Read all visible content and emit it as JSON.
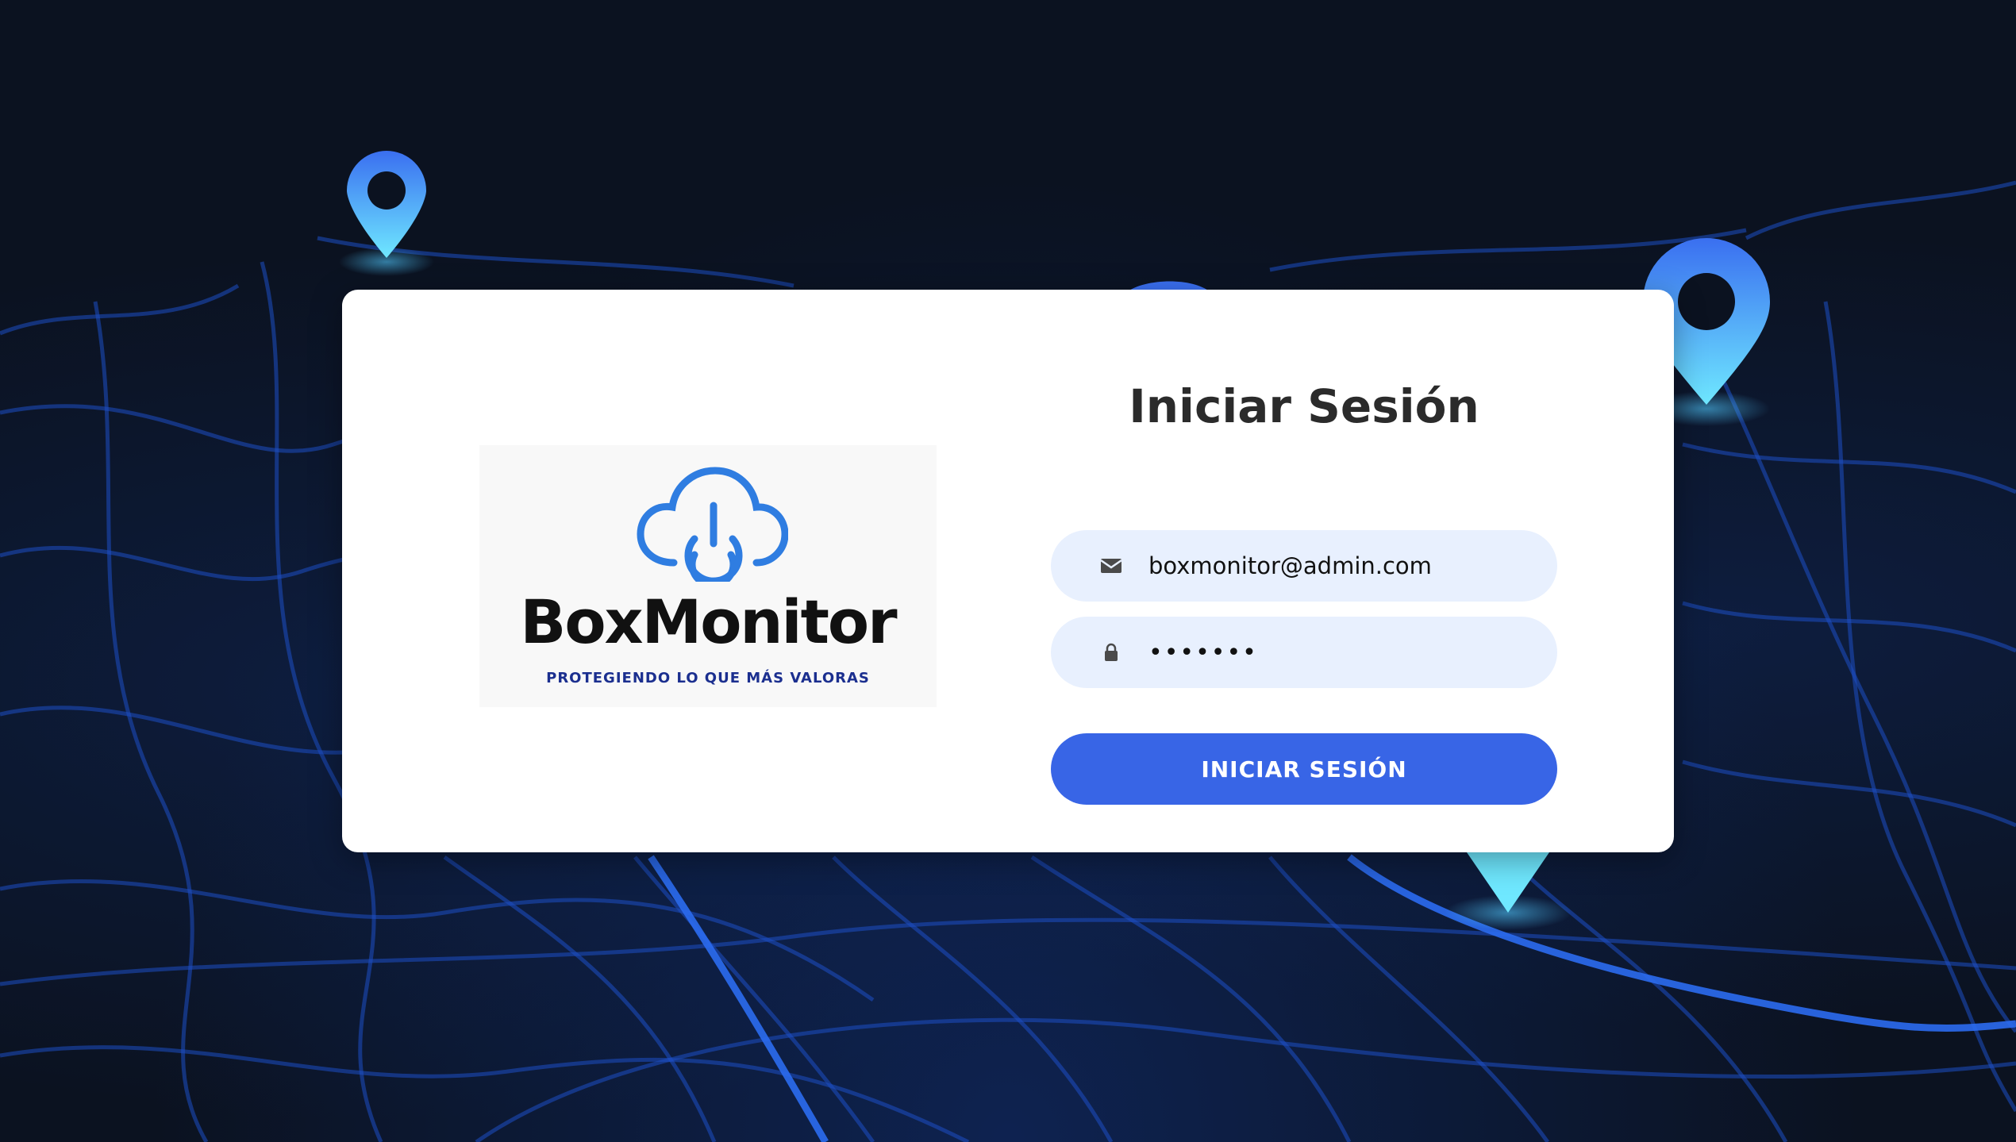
{
  "brand": {
    "name": "BoxMonitor",
    "tagline": "PROTEGIENDO LO QUE MÁS VALORAS",
    "logo_icon": "cloud-power-icon",
    "logo_color": "#2f7de1",
    "tagline_color": "#1b2f8f"
  },
  "login": {
    "title": "Iniciar Sesión",
    "email": {
      "icon": "envelope-icon",
      "value": "boxmonitor@admin.com"
    },
    "password": {
      "icon": "lock-icon",
      "value": "•••••••"
    },
    "submit_label": "INICIAR SESIÓN"
  },
  "theme": {
    "accent": "#3865e6",
    "field_bg": "#e8f0fe",
    "background": "#0b1220",
    "map_lines": "#1d4fc4",
    "pin_color": "#4fc3f7"
  }
}
